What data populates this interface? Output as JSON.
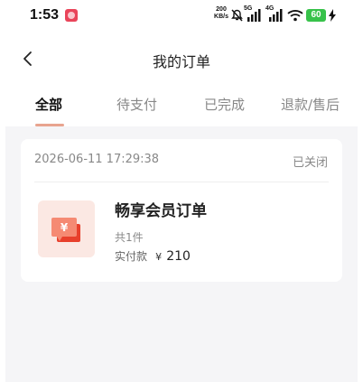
{
  "status_bar": {
    "time": "1:53",
    "net_speed_value": "200",
    "net_speed_unit": "KB/s",
    "signal_1_label": "5G",
    "signal_2_label": "4G",
    "battery": "60",
    "icons": [
      "app-badge-icon",
      "mute-icon",
      "signal-icon",
      "wifi-icon",
      "battery-icon",
      "charging-icon"
    ]
  },
  "nav": {
    "title": "我的订单",
    "back_icon": "chevron-left-icon"
  },
  "tabs": [
    {
      "label": "全部",
      "active": true
    },
    {
      "label": "待支付",
      "active": false
    },
    {
      "label": "已完成",
      "active": false
    },
    {
      "label": "退款/售后",
      "active": false
    }
  ],
  "colors": {
    "accent": "#e8a48f",
    "background": "#f5f5f7",
    "product_icon": "#f0604a",
    "battery": "#37c24a"
  },
  "orders": [
    {
      "time": "2026-06-11 17:29:38",
      "status": "已关闭",
      "product_name": "畅享会员订单",
      "quantity": "共1件",
      "paid_label": "实付款",
      "currency": "¥",
      "amount": "210",
      "icon": "money-bills-icon"
    }
  ]
}
